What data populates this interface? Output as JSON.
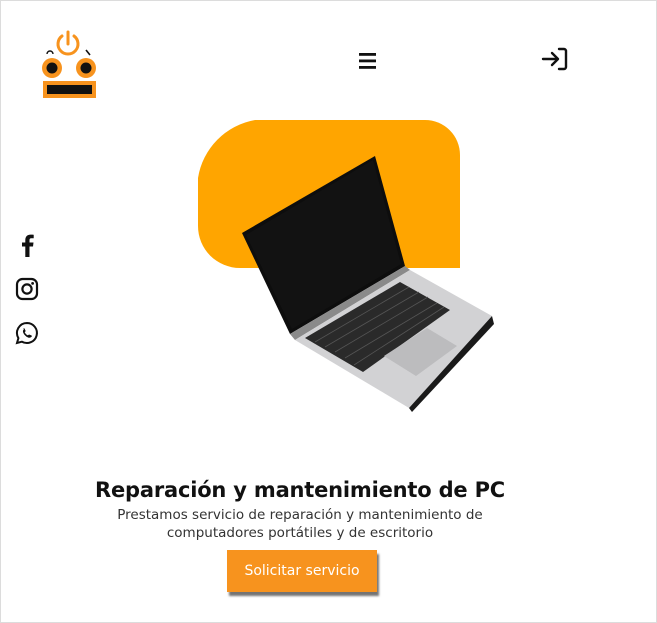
{
  "colors": {
    "accent": "#f7931e",
    "hero_blob": "#ffa500",
    "text": "#111111"
  },
  "header": {
    "logo_icon": "robot-power-logo-icon",
    "menu_icon": "hamburger-menu-icon",
    "login_icon": "sign-in-icon"
  },
  "social": [
    {
      "icon": "facebook-icon"
    },
    {
      "icon": "instagram-icon"
    },
    {
      "icon": "whatsapp-icon"
    }
  ],
  "hero": {
    "image": "laptop-image"
  },
  "main": {
    "title": "Reparación y mantenimiento de PC",
    "subtitle_line1": "Prestamos servicio de reparación y mantenimiento de",
    "subtitle_line2": "computadores portátiles y de escritorio",
    "cta_label": "Solicitar servicio"
  }
}
